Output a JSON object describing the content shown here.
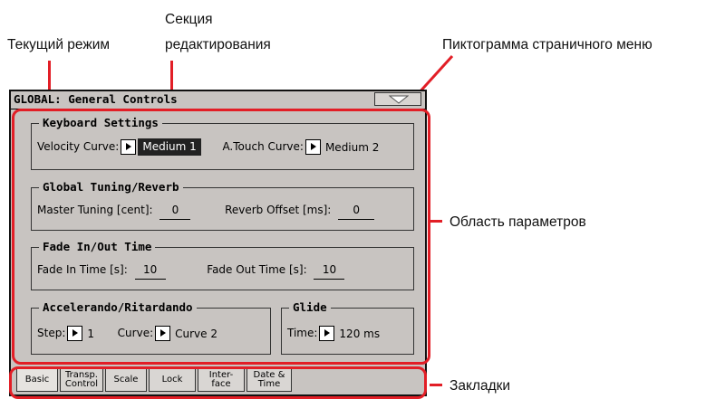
{
  "annotations": {
    "current_mode": "Текущий режим",
    "edit_section_line1": "Секция",
    "edit_section_line2": "редактирования",
    "page_menu_icon": "Пиктограмма страничного меню",
    "parameters_area": "Область параметров",
    "tabs": "Закладки",
    "line_color": "#e21e26"
  },
  "header": {
    "mode": "GLOBAL:",
    "section": "General Controls",
    "menu_icon": "triangle-down-icon"
  },
  "keyboard_settings": {
    "title": "Keyboard Settings",
    "velocity_label": "Velocity Curve:",
    "velocity_value": "Medium 1",
    "atouch_label": "A.Touch Curve:",
    "atouch_value": "Medium 2"
  },
  "tuning": {
    "title": "Global Tuning/Reverb",
    "master_label": "Master Tuning [cent]:",
    "master_value": "0",
    "reverb_label": "Reverb Offset [ms]:",
    "reverb_value": "0"
  },
  "fade": {
    "title": "Fade In/Out Time",
    "in_label": "Fade In Time [s]:",
    "in_value": "10",
    "out_label": "Fade Out Time [s]:",
    "out_value": "10"
  },
  "accel": {
    "title": "Accelerando/Ritardando",
    "step_label": "Step:",
    "step_value": "1",
    "curve_label": "Curve:",
    "curve_value": "Curve 2"
  },
  "glide": {
    "title": "Glide",
    "time_label": "Time:",
    "time_value": "120 ms"
  },
  "tabs": [
    {
      "line1": "Basic",
      "line2": ""
    },
    {
      "line1": "Transp.",
      "line2": "Control"
    },
    {
      "line1": "Scale",
      "line2": ""
    },
    {
      "line1": "Lock",
      "line2": ""
    },
    {
      "line1": "Inter-",
      "line2": "face"
    },
    {
      "line1": "Date &",
      "line2": "Time"
    }
  ]
}
